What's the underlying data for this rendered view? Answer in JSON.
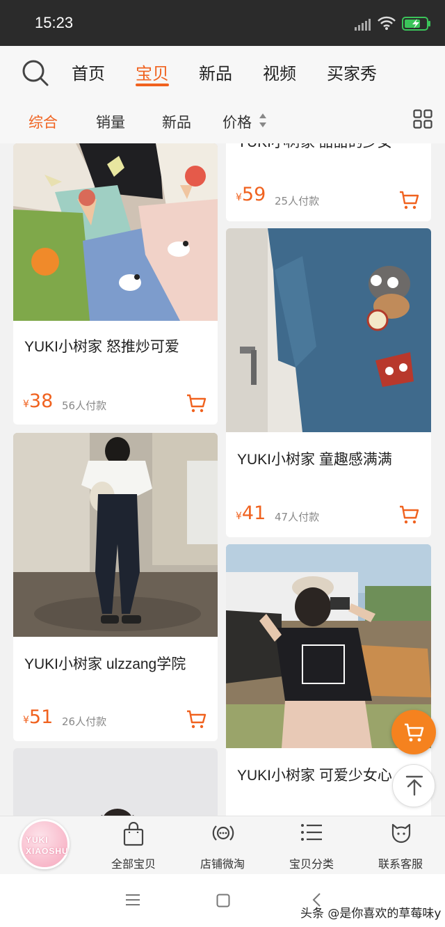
{
  "status_bar": {
    "time": "15:23"
  },
  "top_nav": {
    "tabs": [
      {
        "label": "首页"
      },
      {
        "label": "宝贝",
        "active": true
      },
      {
        "label": "新品"
      },
      {
        "label": "视频"
      },
      {
        "label": "买家秀"
      }
    ]
  },
  "sort_bar": {
    "options": [
      "综合",
      "销量",
      "新品",
      "价格"
    ],
    "active": "综合"
  },
  "products": [
    {
      "title": "YUKI小树家 甜甜的少女",
      "currency": "¥",
      "price": "59",
      "sold": "25人付款"
    },
    {
      "title": "YUKI小树家 怒推炒可爱",
      "currency": "¥",
      "price": "38",
      "sold": "56人付款"
    },
    {
      "title": "YUKI小树家 童趣感满满",
      "currency": "¥",
      "price": "41",
      "sold": "47人付款"
    },
    {
      "title": "YUKI小树家 ulzzang学院",
      "currency": "¥",
      "price": "51",
      "sold": "26人付款"
    },
    {
      "title": "YUKI小树家 可爱少女心"
    }
  ],
  "shop_logo": {
    "line1": "YUKI",
    "line2": "XIAOSHU"
  },
  "bottom_bar": {
    "items": [
      {
        "label": "全部宝贝",
        "icon": "shopping-bag-icon"
      },
      {
        "label": "店铺微淘",
        "icon": "broadcast-icon"
      },
      {
        "label": "宝贝分类",
        "icon": "category-list-icon"
      },
      {
        "label": "联系客服",
        "icon": "customer-service-icon"
      }
    ]
  },
  "watermark": "头条 @是你喜欢的草莓味y",
  "colors": {
    "accent": "#f0621f",
    "fab": "#f5821f",
    "status_bar": "#2b2b2b"
  }
}
